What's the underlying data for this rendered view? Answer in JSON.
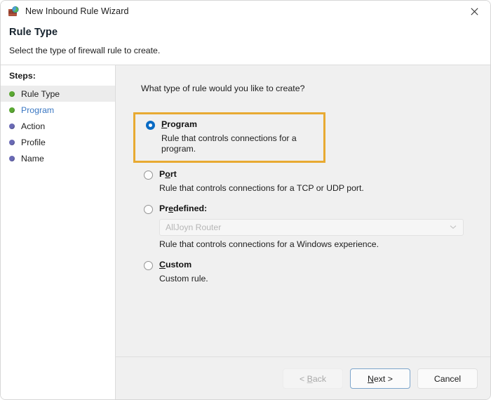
{
  "window": {
    "title": "New Inbound Rule Wizard",
    "app_icon": "firewall-globe-icon",
    "close_icon": "close-icon"
  },
  "header": {
    "title": "Rule Type",
    "subtitle": "Select the type of firewall rule to create."
  },
  "sidebar": {
    "label": "Steps:",
    "items": [
      {
        "label": "Rule Type",
        "bullet": "green",
        "state": "current"
      },
      {
        "label": "Program",
        "bullet": "green",
        "state": "link"
      },
      {
        "label": "Action",
        "bullet": "blue",
        "state": "normal"
      },
      {
        "label": "Profile",
        "bullet": "blue",
        "state": "normal"
      },
      {
        "label": "Name",
        "bullet": "blue",
        "state": "normal"
      }
    ]
  },
  "main": {
    "question": "What type of rule would you like to create?",
    "options": [
      {
        "title": "Program",
        "accel_before": "P",
        "accel_after": "rogram",
        "description": "Rule that controls connections for a program.",
        "selected": true,
        "highlighted": true
      },
      {
        "title": "Port",
        "accel_before": "P",
        "accel_mid": "o",
        "accel_after": "rt",
        "description": "Rule that controls connections for a TCP or UDP port.",
        "selected": false,
        "highlighted": false
      },
      {
        "title": "Predefined:",
        "accel_before": "Pr",
        "accel_mid": "e",
        "accel_after": "defined:",
        "description": "Rule that controls connections for a Windows experience.",
        "selected": false,
        "highlighted": false
      },
      {
        "title": "Custom",
        "accel_before": "C",
        "accel_after": "ustom",
        "description": "Custom rule.",
        "selected": false,
        "highlighted": false
      }
    ],
    "predefined_combo": {
      "value": "AllJoyn Router",
      "disabled": true,
      "chevron_icon": "chevron-down-icon"
    }
  },
  "footer": {
    "back_label": "< Back",
    "back_accel": "B",
    "next_label": "Next >",
    "next_accel": "N",
    "cancel_label": "Cancel"
  },
  "colors": {
    "highlight_border": "#e8aa32",
    "radio_selected": "#0a6bc4",
    "link_text": "#3b78c3",
    "step_done": "#5aa832",
    "step_todo": "#6a6ab5",
    "content_bg": "#f0f0f0"
  }
}
